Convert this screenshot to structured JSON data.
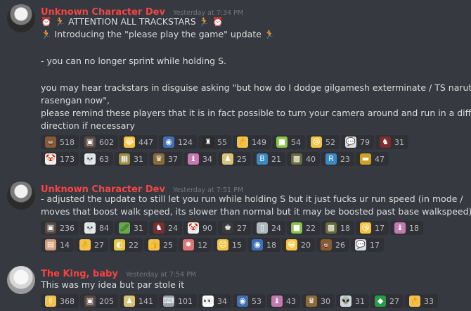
{
  "messages": [
    {
      "username": "Unknown Character Dev",
      "timestamp": "Yesterday at 7:34 PM",
      "lines": [
        "⏰ 🏃  ATTENTION ALL TRACKSTARS 🏃 ⏰",
        "🏃 Introducing the \"please play the game\" update 🏃",
        "",
        "- you can no longer sprint while holding S.",
        "",
        "you may hear trackstars in disguise asking \"but how do I dodge gilgamesh exterminate / TS naruto",
        "rasengan now\",",
        "please remind these players that it is in fact possible to turn your camera around and run in a different",
        "direction if necessary"
      ],
      "reactions": [
        [
          {
            "icon": "poop-icon",
            "glyph": "💩",
            "bg": "#8b5a2b",
            "count": "518"
          },
          {
            "icon": "custom-emoji-icon",
            "glyph": "▣",
            "bg": "#5a4a42",
            "count": "602"
          },
          {
            "icon": "joy-icon",
            "glyph": "😂",
            "bg": "#f4c542",
            "count": "447"
          },
          {
            "icon": "custom-emoji-icon",
            "glyph": "◉",
            "bg": "#3f6fb5",
            "count": "124"
          },
          {
            "icon": "custom-emoji-icon",
            "glyph": "♜",
            "bg": "#2b2b2b",
            "count": "55"
          },
          {
            "icon": "ok-hand-icon",
            "glyph": "👌",
            "bg": "#f2c14e",
            "count": "149"
          },
          {
            "icon": "custom-emoji-icon",
            "glyph": "■",
            "bg": "#8bc34a",
            "count": "54"
          },
          {
            "icon": "crying-icon",
            "glyph": "😢",
            "bg": "#f4c542",
            "count": "52"
          },
          {
            "icon": "speech-bubble-icon",
            "glyph": "💬",
            "bg": "#dcddde",
            "count": "79"
          },
          {
            "icon": "custom-emoji-icon",
            "glyph": "♞",
            "bg": "#7a2e2e",
            "count": "31"
          }
        ],
        [
          {
            "icon": "clown-icon",
            "glyph": "🤡",
            "bg": "#f0f0f0",
            "count": "173"
          },
          {
            "icon": "skull-icon",
            "glyph": "💀",
            "bg": "#e8e8e8",
            "count": "63"
          },
          {
            "icon": "custom-emoji-icon",
            "glyph": "▦",
            "bg": "#9a8f3c",
            "count": "31"
          },
          {
            "icon": "custom-emoji-icon",
            "glyph": "♛",
            "bg": "#8b6b3a",
            "count": "37"
          },
          {
            "icon": "custom-emoji-icon",
            "glyph": "♝",
            "bg": "#c47ab0",
            "count": "34"
          },
          {
            "icon": "custom-emoji-icon",
            "glyph": "♟",
            "bg": "#d9c27a",
            "count": "25"
          },
          {
            "icon": "letter-b-icon",
            "glyph": "B",
            "bg": "#3b88c3",
            "count": "21"
          },
          {
            "icon": "custom-emoji-icon",
            "glyph": "▩",
            "bg": "#6b6b3a",
            "count": "40"
          },
          {
            "icon": "letter-r-icon",
            "glyph": "R",
            "bg": "#3b88c3",
            "count": "23"
          },
          {
            "icon": "custom-emoji-icon",
            "glyph": "▬",
            "bg": "#c9a227",
            "count": "47"
          }
        ]
      ]
    },
    {
      "username": "Unknown Character Dev",
      "timestamp": "Yesterday at 7:51 PM",
      "lines": [
        "- adjusted the update to still let you run while holding S but it just fucks ur run speed (in mode /",
        "moves that boost walk speed, its slower than normal but it may be boosted past base walkspeed)"
      ],
      "reactions": [
        [
          {
            "icon": "custom-emoji-icon",
            "glyph": "▣",
            "bg": "#5a4a42",
            "count": "236"
          },
          {
            "icon": "skull-icon",
            "glyph": "💀",
            "bg": "#e8e8e8",
            "count": "84"
          },
          {
            "icon": "cucumber-icon",
            "glyph": "🥒",
            "bg": "#6aa84f",
            "count": "31"
          },
          {
            "icon": "custom-emoji-icon",
            "glyph": "♞",
            "bg": "#7a2e2e",
            "count": "24"
          },
          {
            "icon": "clown-icon",
            "glyph": "🤡",
            "bg": "#f0f0f0",
            "count": "90"
          },
          {
            "icon": "custom-emoji-icon",
            "glyph": "♚",
            "bg": "#3a3a3a",
            "count": "27"
          },
          {
            "icon": "custom-emoji-icon",
            "glyph": "▯",
            "bg": "#b0b8c0",
            "count": "24"
          },
          {
            "icon": "custom-emoji-icon",
            "glyph": "■",
            "bg": "#8bc34a",
            "count": "22"
          },
          {
            "icon": "custom-emoji-icon",
            "glyph": "▩",
            "bg": "#6b6b3a",
            "count": "18"
          },
          {
            "icon": "kissing-face-icon",
            "glyph": "😘",
            "bg": "#f4c542",
            "count": "17"
          },
          {
            "icon": "custom-emoji-icon",
            "glyph": "♝",
            "bg": "#c47ab0",
            "count": "18"
          }
        ],
        [
          {
            "icon": "custom-emoji-icon",
            "glyph": "▤",
            "bg": "#d49a7a",
            "count": "14"
          },
          {
            "icon": "ok-hand-icon",
            "glyph": "👌",
            "bg": "#f2c14e",
            "count": "27"
          },
          {
            "icon": "custom-emoji-icon",
            "glyph": "◐",
            "bg": "#e6c84a",
            "count": "22"
          },
          {
            "icon": "thumbs-up-icon",
            "glyph": "👍",
            "bg": "#f2c14e",
            "count": "25"
          },
          {
            "icon": "custom-emoji-icon",
            "glyph": "✸",
            "bg": "#e57373",
            "count": "12"
          },
          {
            "icon": "pensive-face-icon",
            "glyph": "😔",
            "bg": "#f4c542",
            "count": "15"
          },
          {
            "icon": "custom-emoji-icon",
            "glyph": "◉",
            "bg": "#3f6fb5",
            "count": "18"
          },
          {
            "icon": "grinning-face-icon",
            "glyph": "😁",
            "bg": "#f4c542",
            "count": "20"
          },
          {
            "icon": "poop-icon",
            "glyph": "💩",
            "bg": "#8b5a2b",
            "count": "26"
          },
          {
            "icon": "speech-bubble-icon",
            "glyph": "💬",
            "bg": "#dcddde",
            "count": "17"
          }
        ]
      ]
    },
    {
      "username": "The King, baby",
      "timestamp": "Yesterday at 7:54 PM",
      "lines": [
        "This was my idea but par stole it"
      ],
      "reactions": [
        [
          {
            "icon": "victory-hand-icon",
            "glyph": "✌",
            "bg": "#f2c14e",
            "count": "368"
          },
          {
            "icon": "custom-emoji-icon",
            "glyph": "▣",
            "bg": "#5a4a42",
            "count": "205"
          },
          {
            "icon": "custom-emoji-icon",
            "glyph": "♟",
            "bg": "#d9c27a",
            "count": "141"
          },
          {
            "icon": "keyboard-icon",
            "glyph": "⌨",
            "bg": "#9aa4ad",
            "count": "101"
          },
          {
            "icon": "eyes-icon",
            "glyph": "👀",
            "bg": "#ffffff",
            "count": "34"
          },
          {
            "icon": "custom-emoji-icon",
            "glyph": "◉",
            "bg": "#3f6fb5",
            "count": "53"
          },
          {
            "icon": "custom-emoji-icon",
            "glyph": "♝",
            "bg": "#c47ab0",
            "count": "43"
          },
          {
            "icon": "custom-emoji-icon",
            "glyph": "♛",
            "bg": "#8b6b3a",
            "count": "30"
          },
          {
            "icon": "alien-icon",
            "glyph": "👽",
            "bg": "#cfd8dc",
            "count": "31"
          },
          {
            "icon": "brazil-flag-icon",
            "glyph": "◆",
            "bg": "#229e45",
            "count": "27"
          },
          {
            "icon": "ok-hand-icon",
            "glyph": "👌",
            "bg": "#f2c14e",
            "count": "33"
          }
        ]
      ]
    }
  ]
}
